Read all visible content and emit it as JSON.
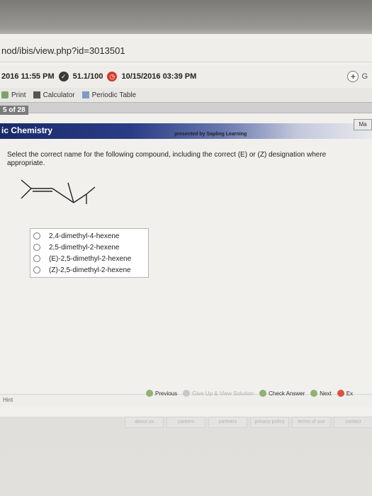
{
  "browser": {
    "url": "nod/ibis/view.php?id=3013501"
  },
  "info_bar": {
    "start_time": "2016 11:55 PM",
    "score": "51.1/100",
    "due_time": "10/15/2016 03:39 PM",
    "right_letter": "G"
  },
  "tools": {
    "print": "Print",
    "calculator": "Calculator",
    "periodic_table": "Periodic Table"
  },
  "page_counter": "5 of 28",
  "header": {
    "title": "ic Chemistry",
    "presented_by": "presented by Sapling Learning",
    "side_tab": "Ma"
  },
  "question": {
    "text": "Select the correct name for the following compound, including the correct (E) or (Z) designation where appropriate."
  },
  "choices": [
    "2,4-dimethyl-4-hexene",
    "2,5-dimethyl-2-hexene",
    "(E)-2,5-dimethyl-2-hexene",
    "(Z)-2,5-dimethyl-2-hexene"
  ],
  "bottom": {
    "hint": "Hint",
    "previous": "Previous",
    "give_up": "Give Up & View Solution",
    "check_answer": "Check Answer",
    "next": "Next",
    "exit": "Ex"
  },
  "footer": [
    "about us",
    "careers",
    "partners",
    "privacy policy",
    "terms of use",
    "contact"
  ],
  "colors": {
    "header_start": "#1a2a68",
    "accent_green": "#8fb274",
    "exit_red": "#d9533c"
  }
}
